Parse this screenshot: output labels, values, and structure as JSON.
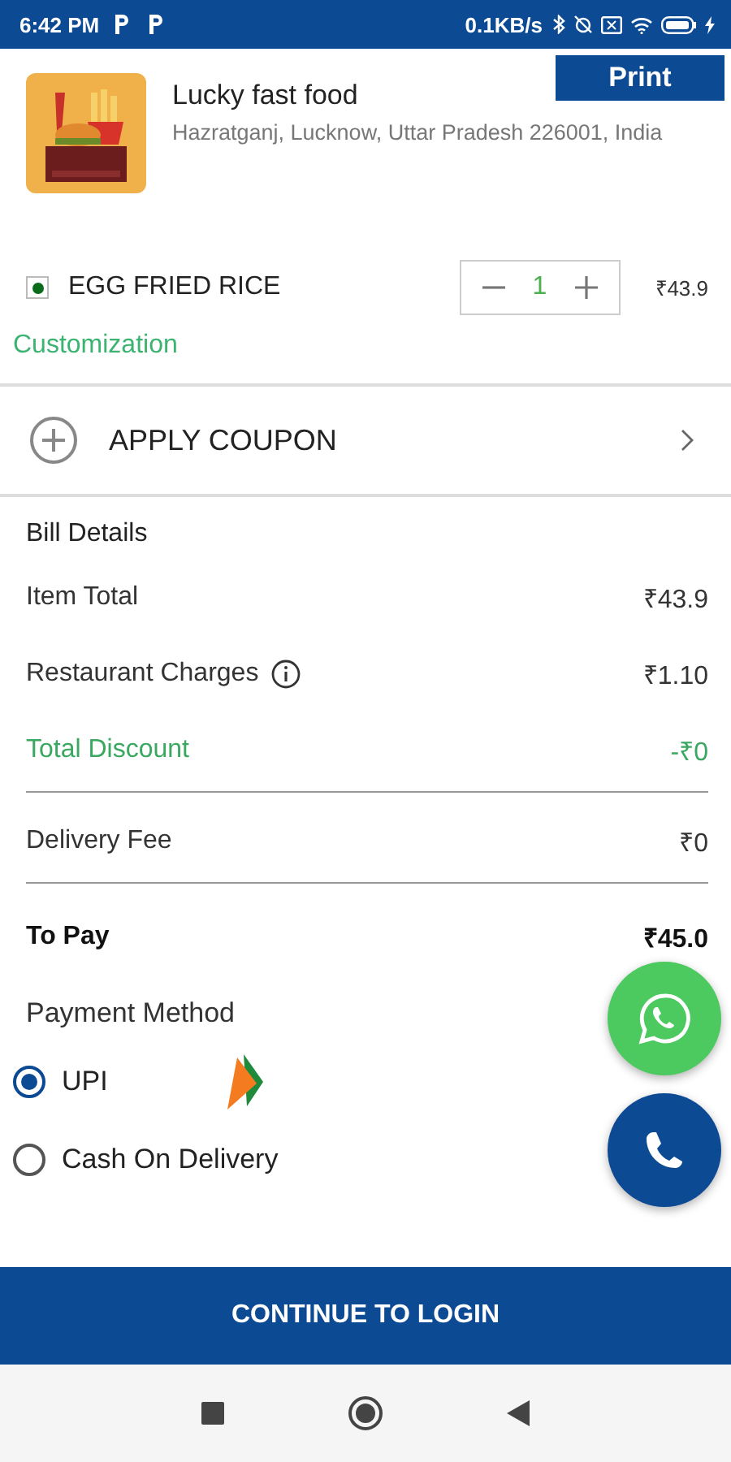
{
  "status_bar": {
    "time": "6:42 PM",
    "speed": "0.1KB/s"
  },
  "restaurant": {
    "name": "Lucky fast food",
    "address": "Hazratganj, Lucknow, Uttar Pradesh 226001, India"
  },
  "print_button": "Print",
  "cart_items": [
    {
      "name": "EGG FRIED RICE",
      "veg": true,
      "quantity": "1",
      "price": "₹43.9",
      "customization": "Customization"
    }
  ],
  "coupon": {
    "label": "APPLY COUPON"
  },
  "bill": {
    "title": "Bill Details",
    "groups": [
      {
        "rows": [
          {
            "label": "Item Total",
            "value": "₹43.9",
            "kind": "plain",
            "info": false
          },
          {
            "label": "Restaurant Charges",
            "value": "₹1.10",
            "kind": "plain",
            "info": true
          },
          {
            "label": "Total Discount",
            "value": "-₹0",
            "kind": "discount",
            "info": false
          }
        ]
      },
      {
        "rows": [
          {
            "label": "Delivery Fee",
            "value": "₹0",
            "kind": "plain",
            "info": false
          }
        ]
      },
      {
        "rows": [
          {
            "label": "To Pay",
            "value": "₹45.0",
            "kind": "total",
            "info": false
          }
        ]
      }
    ]
  },
  "payment": {
    "title": "Payment Method",
    "options": [
      {
        "label": "UPI",
        "selected": true,
        "logo": true
      },
      {
        "label": "Cash On Delivery",
        "selected": false,
        "logo": false
      }
    ]
  },
  "continue_button": "CONTINUE TO LOGIN"
}
